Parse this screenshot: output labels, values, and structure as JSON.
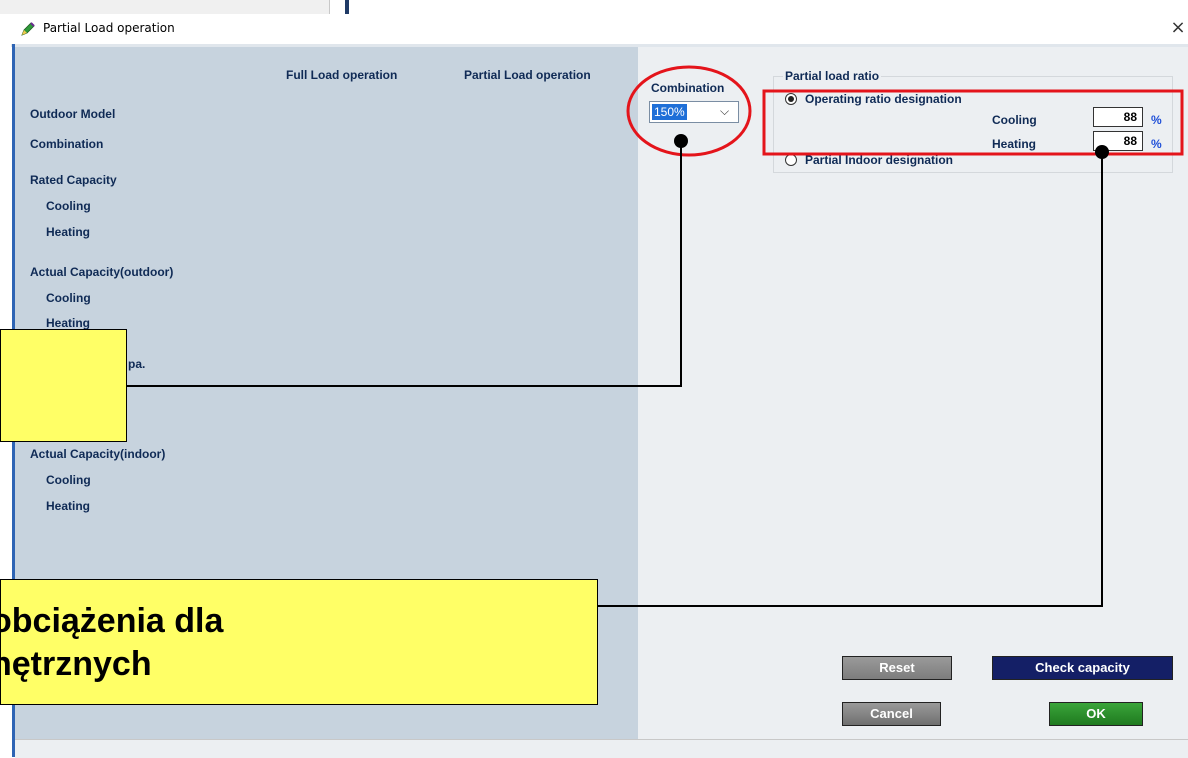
{
  "window": {
    "title": "Partial Load operation",
    "close_glyph": "×"
  },
  "left_pane": {
    "col_full": "Full Load operation",
    "col_partial": "Partial Load operation",
    "rows": {
      "outdoor_model": "Outdoor Model",
      "combination": "Combination",
      "rated_capacity": "Rated Capacity",
      "rated_cooling": "Cooling",
      "rated_heating": "Heating",
      "actual_outdoor": "Actual Capacity(outdoor)",
      "actual_outdoor_cooling": "Cooling",
      "actual_outdoor_heating": "Heating",
      "partial_capa": "pa.",
      "actual_indoor": "Actual Capacity(indoor)",
      "actual_indoor_cooling": "Cooling",
      "actual_indoor_heating": "Heating"
    }
  },
  "combination": {
    "label": "Combination",
    "value": "150%",
    "arrow_glyph": "⌵"
  },
  "partial_load_ratio": {
    "legend": "Partial load ratio",
    "option_operating": "Operating ratio designation",
    "option_indoor": "Partial Indoor designation",
    "selected": "operating",
    "cooling_label": "Cooling",
    "heating_label": "Heating",
    "cooling_value": "88",
    "heating_value": "88",
    "unit": "%"
  },
  "buttons": {
    "reset": "Reset",
    "check_capacity": "Check capacity",
    "cancel": "Cancel",
    "ok": "OK"
  },
  "annotations": {
    "callout_2_line1": "obciążenia dla",
    "callout_2_line2": "nętrznych",
    "highlight_color": "#e4141b",
    "callout_color": "#ffff66"
  }
}
